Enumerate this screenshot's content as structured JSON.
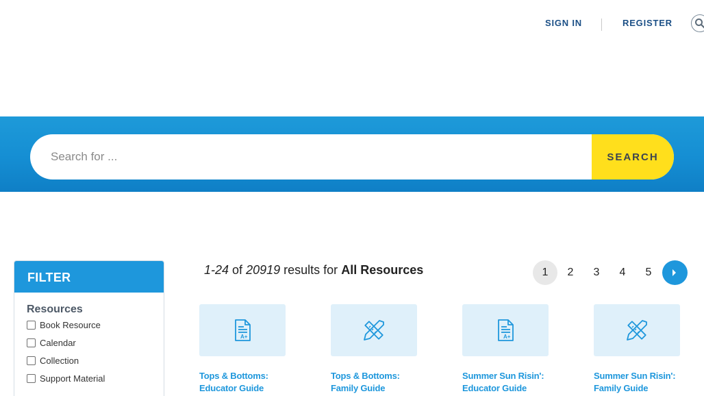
{
  "header": {
    "sign_in": "SIGN IN",
    "register": "REGISTER",
    "search_icon": "search-icon"
  },
  "search": {
    "placeholder": "Search for ...",
    "button_label": "SEARCH"
  },
  "filter": {
    "title": "FILTER",
    "group_title": "Resources",
    "options": [
      {
        "label": "Book Resource",
        "checked": false
      },
      {
        "label": "Calendar",
        "checked": false
      },
      {
        "label": "Collection",
        "checked": false
      },
      {
        "label": "Support Material",
        "checked": false
      }
    ]
  },
  "results": {
    "range": "1-24",
    "of_word": "of",
    "total": "20919",
    "results_for": "results for",
    "scope": "All Resources"
  },
  "pagination": {
    "pages": [
      "1",
      "2",
      "3",
      "4",
      "5"
    ],
    "current": "1",
    "next_icon": "chevron-right-icon"
  },
  "cards": [
    {
      "title_line1": "Tops & Bottoms:",
      "title_line2": "Educator Guide",
      "icon": "document-grade-icon"
    },
    {
      "title_line1": "Tops & Bottoms:",
      "title_line2": "Family Guide",
      "icon": "pencil-ruler-icon"
    },
    {
      "title_line1": "Summer Sun Risin':",
      "title_line2": "Educator Guide",
      "icon": "document-grade-icon"
    },
    {
      "title_line1": "Summer Sun Risin':",
      "title_line2": "Family Guide",
      "icon": "pencil-ruler-icon"
    }
  ],
  "colors": {
    "brand_blue": "#1e97dc",
    "nav_text": "#1b4f86",
    "search_button": "#ffdf1c",
    "thumb_bg": "#dff0fa"
  }
}
